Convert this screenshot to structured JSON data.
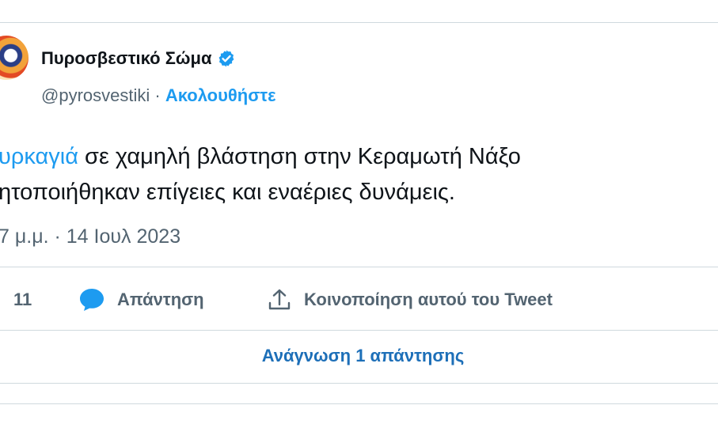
{
  "author": {
    "display_name": "Πυροσβεστικό Σώμα",
    "handle": "@pyrosvestiki",
    "separator": " · ",
    "follow_label": "Ακολουθήστε"
  },
  "tweet": {
    "hashtag": "υρκαγιά",
    "line1_rest": " σε χαμηλή βλάστηση στην Κεραμωτή Νάξο",
    "line2": "ητοποιήθηκαν επίγειες και εναέριες δυνάμεις.",
    "timestamp": "7 μ.μ. · 14 Ιουλ 2023"
  },
  "actions": {
    "like_count": "11",
    "reply_label": "Απάντηση",
    "share_label": "Κοινοποίηση αυτού του Tweet"
  },
  "read_replies_label": "Ανάγνωση 1 απάντησης",
  "colors": {
    "accent": "#1d9bf0",
    "muted": "#536471",
    "text": "#0f1419",
    "border": "#cfd9de"
  },
  "icons": {
    "verified": "verified-badge-icon",
    "reply": "speech-bubble-icon",
    "share": "share-upload-icon"
  }
}
